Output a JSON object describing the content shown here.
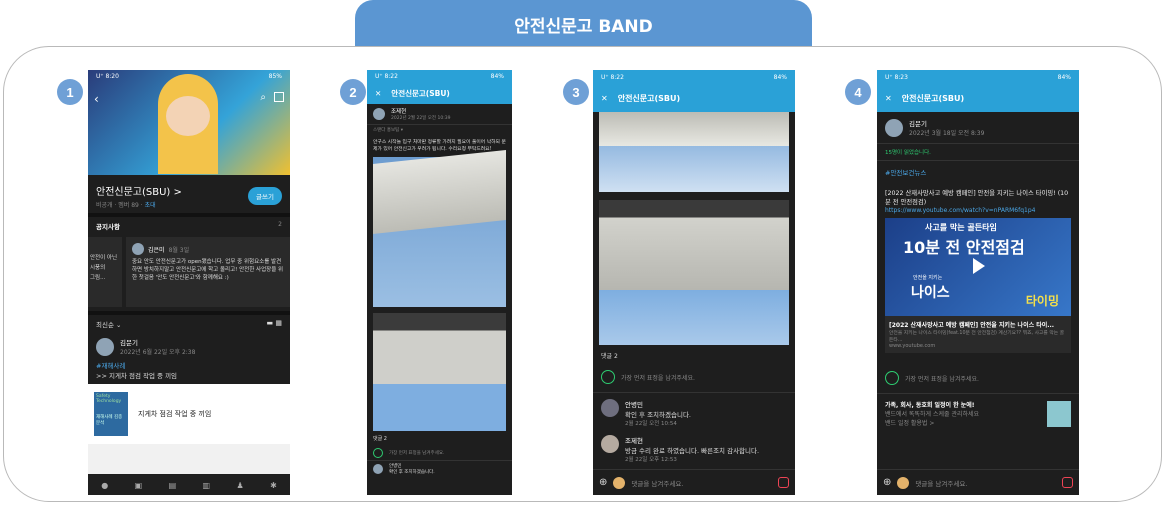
{
  "header_title": "안전신문고 BAND",
  "badges": [
    "1",
    "2",
    "3",
    "4"
  ],
  "phone1": {
    "status_time": "U⁺ 8:20",
    "status_batt": "85%",
    "band_name": "안전신문고(SBU) >",
    "band_meta": "비공개 · 멤버 89 · ",
    "invite": "초대",
    "write_button": "글쓰기",
    "notice_label": "공지사항",
    "notice_count": "2",
    "notice_left_lines": [
      "안전이 아닌",
      "시풍의",
      "그림..."
    ],
    "notice_author": "김은미",
    "notice_date": "8월 3일",
    "notice_text": "중요 안도 안전신문고가 open됐습니다. 업무 중 위험요소를 발견하면 방치하지말고 안전신문고에 학고 올리고! 안전한 사업장을 위한 첫걸음 '안도 안전신문고'와 함께해요 :)",
    "sort_label": "최신순 ⌄",
    "post_author": "김문기",
    "post_date": "2022년 6월 22일 오후 2:38",
    "post_tag": "#재해사례",
    "post_text": ">> 지게차 점검 작업 중 끼임",
    "card_logo": "Safety Technology",
    "card_sub": "재해사례 김종분석",
    "card_title": "지게차 점검 작업 중 끼임"
  },
  "phone2": {
    "status_time": "U⁺ 8:22",
    "status_batt": "84%",
    "title": "안전신문고(SBU)",
    "author": "조제현",
    "date": "2022년 2월 22일 오전 10:39",
    "tag_line": "스탠다 홍보팀 ▾",
    "body": "안구스 시작늘 입구 처마판 정류할 가려지 필요이 풀이어 낙하되 문제가 있어 안전신고가 우려가 됩니다. 수리요청 부탁드려요!",
    "comments": "댓글 2",
    "reaction": "가장 먼저 표정을 남겨주세요.",
    "c1_author": "안병민",
    "c1_text": "확인 후 조치하겠습니다."
  },
  "phone3": {
    "status_time": "U⁺ 8:22",
    "status_batt": "84%",
    "title": "안전신문고(SBU)",
    "comments": "댓글 2",
    "reaction": "가장 먼저 표정을 남겨주세요.",
    "c1_author": "안병민",
    "c1_text": "확인 후 조치하겠습니다.",
    "c1_date": "2월 22일 오전 10:54",
    "c2_author": "조제현",
    "c2_text": "방금 수리 완료 하였습니다. 빠른조치 감사합니다.",
    "c2_date": "2월 22일 오후 12:53",
    "input_placeholder": "댓글을 남겨주세요."
  },
  "phone4": {
    "status_time": "U⁺ 8:23",
    "status_batt": "84%",
    "title": "안전신문고(SBU)",
    "author": "김문기",
    "date": "2022년 3월 18일 오전 8:39",
    "readers": "15명이 읽었습니다.",
    "tag": "#안전보건뉴스",
    "headline": "[2022 산재사망사고 예방 캠페인] 안전을 지키는 나이스 타이밍! (10분 전 안전점검)",
    "url": "https://www.youtube.com/watch?v=nPARM6fq1p4",
    "thumb_top": "사고를 막는 골든타임",
    "thumb_big": "10분 전 안전점검",
    "thumb_small": "안전을 지키는",
    "thumb_nice": "나이스",
    "thumb_timing": "타이밍",
    "link_title": "[2022 산재사망사고 예방 캠페인] 안전을 지키는 나이스 타이...",
    "link_desc": "안전을 지키는 나이스 타이밍(feat.10분 전 안전점검) 계산기요?? 뭐죠, 사고를 막는 골든타...",
    "link_host": "www.youtube.com",
    "reaction": "가장 먼저 표정을 남겨주세요.",
    "ad_title": "가족, 회사, 동호회 일정이 한 눈에!",
    "ad_desc": "밴드에서 똑똑하게 스케줄 관리하세요",
    "ad_link": "밴드 일정 활용법 >",
    "input_placeholder": "댓글을 남겨주세요."
  },
  "colors": {
    "accent": "#5b96d2",
    "band": "#2aa1d7",
    "dark": "#1e1e1e"
  }
}
